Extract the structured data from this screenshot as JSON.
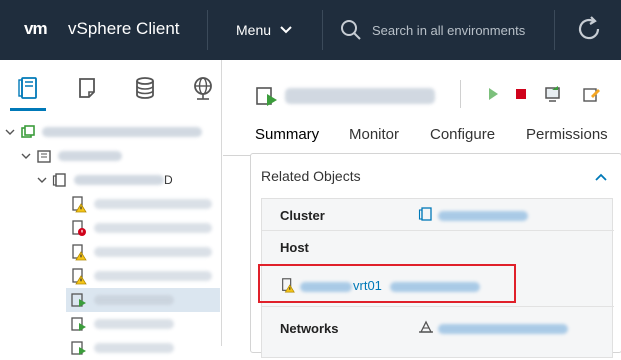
{
  "header": {
    "logo_text": "vm",
    "app_title": "vSphere Client",
    "menu_label": "Menu",
    "search_placeholder": "Search in all environments",
    "bg_color": "#1f2d3d"
  },
  "left_tabs": [
    {
      "icon": "hosts-and-clusters-icon",
      "active": true
    },
    {
      "icon": "vms-and-templates-icon",
      "active": false
    },
    {
      "icon": "storage-icon",
      "active": false
    },
    {
      "icon": "networking-icon",
      "active": false
    }
  ],
  "tree": {
    "datacenter_suffix": "D",
    "items": [
      {
        "level": 0,
        "icon": "vcenter-icon"
      },
      {
        "level": 1,
        "icon": "datacenter-icon"
      },
      {
        "level": 2,
        "icon": "cluster-icon",
        "suffix": "D"
      },
      {
        "level": 3,
        "icon": "host-warning-icon"
      },
      {
        "level": 3,
        "icon": "host-error-icon"
      },
      {
        "level": 3,
        "icon": "host-warning-icon"
      },
      {
        "level": 3,
        "icon": "host-warning-icon"
      },
      {
        "level": 3,
        "icon": "vm-icon",
        "selected": true
      },
      {
        "level": 3,
        "icon": "vm-icon"
      },
      {
        "level": 3,
        "icon": "vm-icon"
      }
    ]
  },
  "main": {
    "tabs": [
      "Summary",
      "Monitor",
      "Configure",
      "Permissions"
    ],
    "active_tab": "Summary",
    "related_objects": {
      "title": "Related Objects",
      "rows": [
        {
          "label": "Cluster",
          "icon": "cluster-icon"
        },
        {
          "label": "Host",
          "icon": ""
        },
        {
          "label": "",
          "icon": "host-warning-icon",
          "value_visible": "vrt01"
        },
        {
          "label": "Networks",
          "icon": "network-icon"
        }
      ]
    }
  },
  "colors": {
    "accent": "#0079b8",
    "highlight": "#e0202a",
    "play": "#3c9d3c",
    "stop": "#d0021b"
  }
}
